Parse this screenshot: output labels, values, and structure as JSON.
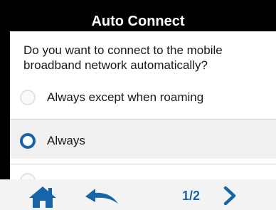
{
  "header": {
    "title": "Auto Connect"
  },
  "prompt": {
    "question": "Do you want to connect to the mobile broadband network automatically?"
  },
  "options": [
    {
      "label": "Always except when roaming",
      "selected": false
    },
    {
      "label": "Always",
      "selected": true
    },
    {
      "label": "",
      "selected": false
    }
  ],
  "footer": {
    "page_indicator": "1/2",
    "home_icon": "home-icon",
    "back_icon": "back-arrow-icon",
    "next_icon": "chevron-right-icon"
  },
  "colors": {
    "accent": "#1565a8",
    "title_bar": "#000000",
    "selected_row": "#f0f0f0"
  }
}
